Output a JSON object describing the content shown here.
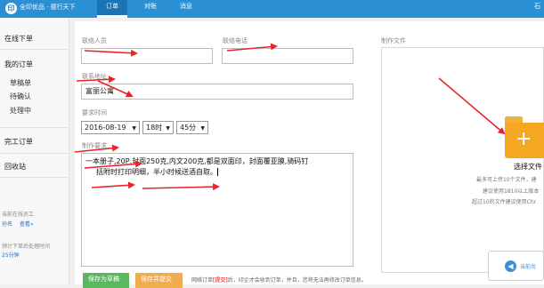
{
  "header": {
    "logo_mark": "印",
    "logo_text": "全印优品 · 德行天下",
    "tabs": [
      "订单",
      "对账",
      "消息"
    ],
    "right_text": "石"
  },
  "sidebar": {
    "online_order": "在线下单",
    "my_orders": "我的订单",
    "sub_items": [
      "草稿单",
      "待确认",
      "处理中"
    ],
    "completed": "完工订单",
    "recycle": "回收站",
    "staff_label": "当前在线员工",
    "staff_name": "孙名",
    "staff_link": "查看»",
    "wait_label": "预计下单后处理时间",
    "wait_value": "25分钟"
  },
  "form": {
    "contact_label": "联络人员",
    "contact_value": "",
    "phone_label": "联络电话",
    "phone_value": "",
    "addr_label": "联系地址",
    "addr_value": "富丽公寓",
    "time_label": "要求时间",
    "date_value": "2016-08-19",
    "hour_value": "18时",
    "minute_value": "45分",
    "req_label": "制作要求",
    "req_line1": "一本册子,20P,封面250克,内文200克,都是双面印，封面覆亚膜,骑码钉",
    "req_line2": "括附时打印明细，半小时候送酒自取。"
  },
  "file": {
    "label": "制作文件",
    "choose": "选择文件",
    "hints": [
      "最多可上传10个文件，建",
      "建议使用1810以上版本",
      "超过10的文件建议使用Chr"
    ]
  },
  "actions": {
    "save_draft": "保存为草稿",
    "save_submit": "保存并提交",
    "note_prefix": "网络订单",
    "note_bracket": "[提交]",
    "note_suffix": "后，印企才会收到订单，并且，您将无法再修改订单信息。"
  },
  "chat": {
    "text": "当前尚"
  },
  "colors": {
    "accent": "#2a8fd3",
    "annotation": "#e8232a",
    "green": "#5cb85c",
    "orange": "#f0ad4e"
  }
}
